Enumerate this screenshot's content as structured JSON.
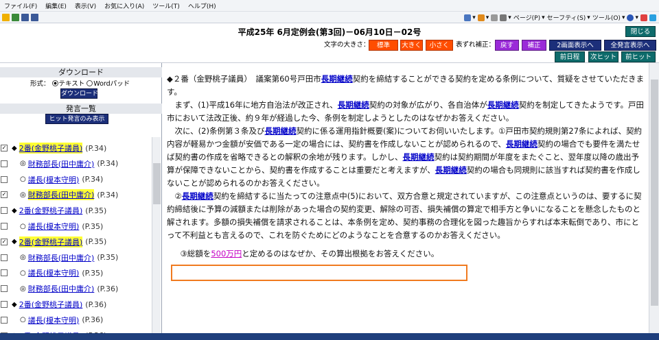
{
  "menubar": [
    "ファイル(F)",
    "編集(E)",
    "表示(V)",
    "お気に入り(A)",
    "ツール(T)",
    "ヘルプ(H)"
  ],
  "cmdbar": {
    "page": "ページ(P)",
    "safety": "セーフティ(S)",
    "tools": "ツール(O)"
  },
  "header": {
    "title": "平成25年 6月定例会(第3回)－06月10日－02号",
    "close": "閉じる",
    "font_size_label": "文字の大きさ：",
    "font_standard": "標準",
    "font_large": "大きく",
    "font_small": "小さく",
    "offset_label": "表ずれ補正：",
    "revert": "戻す",
    "correct": "補正",
    "two_screen": "2画面表示へ",
    "all_speech": "全発言表示へ",
    "prev_day": "前日程",
    "next_hit": "次ヒット",
    "prev_hit": "前ヒット"
  },
  "download": {
    "heading": "ダウンロード",
    "format_label": "形式：",
    "opt_text": "テキスト",
    "opt_word": "Wordパッド",
    "button": "ダウンロード"
  },
  "speech_list": {
    "heading": "発言一覧",
    "hit_only_button": "ヒット発言のみ表示",
    "items": [
      {
        "checked": true,
        "marker": "◆",
        "name": "2番(金野桃子議員)",
        "highlight": true,
        "page": "(P.34)"
      },
      {
        "checked": false,
        "marker": "◎",
        "name": "財務部長(田中庸介)",
        "highlight": false,
        "page": "(P.34)"
      },
      {
        "checked": false,
        "marker": "○",
        "name": "議長(榎本守明)",
        "highlight": false,
        "page": "(P.34)"
      },
      {
        "checked": true,
        "marker": "◎",
        "name": "財務部長(田中庸介)",
        "highlight": true,
        "page": "(P.34)"
      },
      {
        "checked": false,
        "marker": "◆",
        "name": "2番(金野桃子議員)",
        "highlight": false,
        "page": "(P.35)"
      },
      {
        "checked": false,
        "marker": "○",
        "name": "議長(榎本守明)",
        "highlight": false,
        "page": "(P.35)"
      },
      {
        "checked": true,
        "marker": "◆",
        "name": "2番(金野桃子議員)",
        "highlight": true,
        "page": "(P.35)"
      },
      {
        "checked": false,
        "marker": "◎",
        "name": "財務部長(田中庸介)",
        "highlight": false,
        "page": "(P.35)"
      },
      {
        "checked": false,
        "marker": "○",
        "name": "議長(榎本守明)",
        "highlight": false,
        "page": "(P.35)"
      },
      {
        "checked": false,
        "marker": "◎",
        "name": "財務部長(田中庸介)",
        "highlight": false,
        "page": "(P.36)"
      },
      {
        "checked": false,
        "marker": "◆",
        "name": "2番(金野桃子議員)",
        "highlight": false,
        "page": "(P.36)"
      },
      {
        "checked": false,
        "marker": "○",
        "name": "議長(榎本守明)",
        "highlight": false,
        "page": "(P.36)"
      },
      {
        "checked": false,
        "marker": "◆",
        "name": "2番(金野桃子議員)",
        "highlight": false,
        "page": "(P.36)"
      }
    ]
  },
  "transcript": {
    "p1": [
      "◆２番（金野桃子議員）　議案第60号戸田市",
      "長期継続",
      "契約を締結することができる契約を定める条例について、質疑をさせていただきます。"
    ],
    "p2": [
      "　まず、(1)平成16年に地方自治法が改正され、",
      "長期継続",
      "契約の対象が広がり、各自治体が",
      "長期継続",
      "契約を制定してきたようです。戸田市において法改正後、約９年が経過した今、条例を制定しようとしたのはなぜかお答えください。"
    ],
    "p3": [
      "　次に、(2)条例第３条及び",
      "長期継続",
      "契約に係る運用指針概要(案)についてお伺いいたします。①戸田市契約規則第27条によれば、契約内容が軽易かつ金額が安価である一定の場合には、契約書を作成しないことが認められるので、",
      "長期継続",
      "契約の場合でも要件を満たせば契約書の作成を省略できるとの解釈の余地が残ります。しかし、",
      "長期継続",
      "契約は契約期間が年度をまたぐこと、翌年度以降の歳出予算が保障できないことから、契約書を作成することは重要だと考えますが、",
      "長期継続",
      "契約の場合も同規則に該当すれば契約書を作成しないことが認められるのかお答えください。"
    ],
    "p4": [
      "　②",
      "長期継続",
      "契約を締結するに当たっての注意点中(5)において、双方合意と規定されていますが、この注意点というのは、要するに契約締結後に予算の減額または削除があった場合の契約変更、解除の可否、損失補償の算定で相手方と争いになることを懸念したものと解されます。多額の損失補償を請求されることは、本条例を定め、契約事務の合理化を図った趣旨からすれば本末転倒であり、市にとって不利益とも言えるので、これを防ぐためにどのようなことを合意するのかお答えください。"
    ],
    "p5": [
      "　③総額を",
      "500万円",
      "と定めるのはなぜか、その算出根拠をお答えください。"
    ]
  },
  "colors": {
    "highlight_border": "#f07a1f",
    "keyword": "#0000c8",
    "name_highlight": "#ffff33"
  }
}
